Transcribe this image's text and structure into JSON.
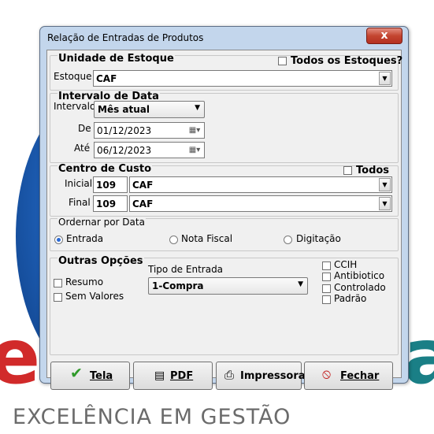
{
  "background": {
    "tagline": "EXCELÊNCIA EM GESTÃO",
    "letter_left": "e",
    "letter_right": "a"
  },
  "window": {
    "title": "Relação de Entradas de Produtos",
    "close_label": "x"
  },
  "unidade": {
    "legend": "Unidade de Estoque",
    "todos_label": "Todos os Estoques?",
    "todos_checked": false,
    "estoque_label": "Estoque",
    "estoque_value": "CAF"
  },
  "intervalo": {
    "legend": "Intervalo de Data",
    "intervalo_label": "Intervalo",
    "intervalo_value": "Mês atual",
    "de_label": "De",
    "de_value": "01/12/2023",
    "ate_label": "Até",
    "ate_value": "06/12/2023"
  },
  "centro": {
    "legend": "Centro de Custo",
    "todos_label": "Todos",
    "todos_checked": false,
    "inicial_label": "Inicial",
    "inicial_code": "109",
    "inicial_name": "CAF",
    "final_label": "Final",
    "final_code": "109",
    "final_name": "CAF"
  },
  "ordenar": {
    "legend": "Ordernar por Data",
    "options": [
      "Entrada",
      "Nota Fiscal",
      "Digitação"
    ],
    "selected": "Entrada"
  },
  "outras": {
    "legend": "Outras Opções",
    "resumo_label": "Resumo",
    "sem_valores_label": "Sem Valores",
    "tipo_label": "Tipo de Entrada",
    "tipo_value": "1-Compra",
    "checks": [
      "CCIH",
      "Antibiotico",
      "Controlado",
      "Padrão"
    ]
  },
  "buttons": {
    "tela_label": "Tela",
    "pdf_label": "PDF",
    "impressora_label": "Impressora",
    "fechar_label": "Fechar"
  },
  "icons": {
    "check": "check-icon",
    "pdf": "pdf-icon",
    "printer": "printer-icon",
    "stop": "stop-icon",
    "calendar": "calendar-icon"
  },
  "colors": {
    "accent_green": "#2f9a2a",
    "accent_red": "#c41e1e",
    "window_frame": "#c3d6ec"
  }
}
